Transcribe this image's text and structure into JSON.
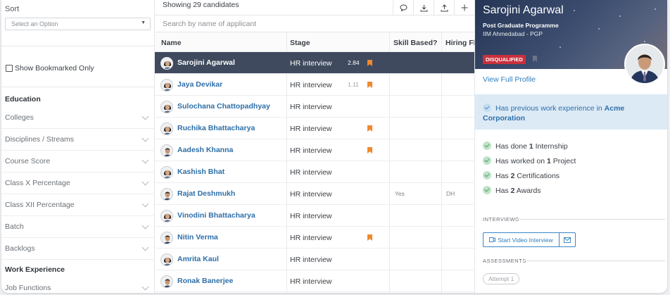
{
  "filters": {
    "sort_label": "Sort",
    "sort_placeholder": "Select an Option",
    "bookmark_label": "Show Bookmarked Only",
    "education_title": "Education",
    "education_items": [
      {
        "label": "Colleges"
      },
      {
        "label": "Disciplines / Streams"
      },
      {
        "label": "Course Score"
      },
      {
        "label": "Class X Percentage"
      },
      {
        "label": "Class XII Percentage"
      },
      {
        "label": "Batch"
      },
      {
        "label": "Backlogs"
      }
    ],
    "work_title": "Work Experience",
    "work_items": [
      {
        "label": "Job Functions"
      }
    ]
  },
  "table": {
    "showing_text": "Showing 29 candidates",
    "search_placeholder": "Search by name of applicant",
    "columns": {
      "name": "Name",
      "stage": "Stage",
      "skill": "Skill Based?",
      "hiring": "Hiring Fl"
    },
    "rows": [
      {
        "name": "Sarojini Agarwal",
        "stage": "HR interview",
        "score": "2.84",
        "bookmarked": true,
        "skill": "",
        "hiring": "",
        "selected": true,
        "avatar": "f"
      },
      {
        "name": "Jaya Devikar",
        "stage": "HR interview",
        "score": "1.11",
        "bookmarked": true,
        "skill": "",
        "hiring": "",
        "selected": false,
        "avatar": "f"
      },
      {
        "name": "Sulochana Chattopadhyay",
        "stage": "HR interview",
        "score": "",
        "bookmarked": false,
        "skill": "",
        "hiring": "",
        "selected": false,
        "avatar": "f"
      },
      {
        "name": "Ruchika Bhattacharya",
        "stage": "HR interview",
        "score": "",
        "bookmarked": true,
        "skill": "",
        "hiring": "",
        "selected": false,
        "avatar": "f"
      },
      {
        "name": "Aadesh Khanna",
        "stage": "HR interview",
        "score": "",
        "bookmarked": true,
        "skill": "",
        "hiring": "",
        "selected": false,
        "avatar": "m"
      },
      {
        "name": "Kashish Bhat",
        "stage": "HR interview",
        "score": "",
        "bookmarked": false,
        "skill": "",
        "hiring": "",
        "selected": false,
        "avatar": "f"
      },
      {
        "name": "Rajat Deshmukh",
        "stage": "HR interview",
        "score": "",
        "bookmarked": false,
        "skill": "Yes",
        "hiring": "DH",
        "selected": false,
        "avatar": "m"
      },
      {
        "name": "Vinodini Bhattacharya",
        "stage": "HR interview",
        "score": "",
        "bookmarked": false,
        "skill": "",
        "hiring": "",
        "selected": false,
        "avatar": "f"
      },
      {
        "name": "Nitin Verma",
        "stage": "HR interview",
        "score": "",
        "bookmarked": true,
        "skill": "",
        "hiring": "",
        "selected": false,
        "avatar": "m"
      },
      {
        "name": "Amrita Kaul",
        "stage": "HR interview",
        "score": "",
        "bookmarked": false,
        "skill": "",
        "hiring": "",
        "selected": false,
        "avatar": "f"
      },
      {
        "name": "Ronak Banerjee",
        "stage": "HR interview",
        "score": "",
        "bookmarked": false,
        "skill": "",
        "hiring": "",
        "selected": false,
        "avatar": "m"
      }
    ]
  },
  "profile": {
    "name": "Sarojini Agarwal",
    "program": "Post Graduate Programme",
    "institute": "IIM Ahmedabad - PGP",
    "status_badge": "DISQUALIFIED",
    "view_profile": "View Full Profile",
    "highlight_prefix": "Has previous work experience in ",
    "highlight_company": "Acme Corporation",
    "achievements": [
      {
        "pre": "Has done ",
        "num": "1",
        "post": " Internship"
      },
      {
        "pre": "Has worked on ",
        "num": "1",
        "post": " Project"
      },
      {
        "pre": "Has ",
        "num": "2",
        "post": " Certifications"
      },
      {
        "pre": "Has ",
        "num": "2",
        "post": " Awards"
      }
    ],
    "interviews_heading": "INTERVIEWS",
    "video_button": "Start Video Interview",
    "assessments_heading": "ASSESSMENTS",
    "attempt_label": "Attempt 1"
  },
  "colors": {
    "accent": "#2e7dbd",
    "selected_row": "#3f4a5e",
    "bookmark": "#f0892f",
    "danger": "#c9303d"
  }
}
